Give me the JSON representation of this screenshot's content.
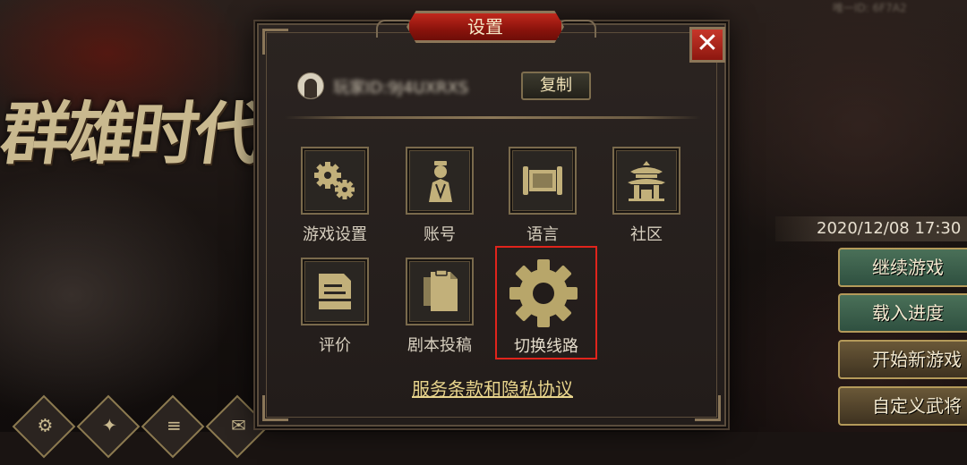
{
  "background": {
    "logo_text": "群雄时代",
    "id_text": "唯一ID: 6F7A2",
    "datetime": "2020/12/08 17:30",
    "menu": [
      {
        "label": "继续游戏",
        "style": "green"
      },
      {
        "label": "载入进度",
        "style": "green"
      },
      {
        "label": "开始新游戏",
        "style": "gold"
      },
      {
        "label": "自定义武将",
        "style": "gold"
      }
    ],
    "bottom_icons": [
      "gear-icon",
      "shop-icon",
      "record-icon",
      "mail-icon"
    ]
  },
  "dialog": {
    "title": "设置",
    "close_glyph": "✕",
    "account": {
      "id_label": "玩家ID:9J4UXRXS",
      "copy_label": "复制"
    },
    "tiles": [
      {
        "label": "游戏设置",
        "icon": "gears-icon"
      },
      {
        "label": "账号",
        "icon": "account-icon"
      },
      {
        "label": "语言",
        "icon": "scroll-icon"
      },
      {
        "label": "社区",
        "icon": "pavilion-icon"
      },
      {
        "label": "评价",
        "icon": "rating-icon"
      },
      {
        "label": "剧本投稿",
        "icon": "script-submit-icon"
      }
    ],
    "switch_route": {
      "label": "切换线路",
      "icon": "gear-icon"
    },
    "terms_link": "服务条款和隐私协议"
  },
  "colors": {
    "highlight": "#e0241c",
    "title_plate": "#a61d14",
    "gold_text": "#e8d48c",
    "icon_gold": "#c2b07a"
  }
}
